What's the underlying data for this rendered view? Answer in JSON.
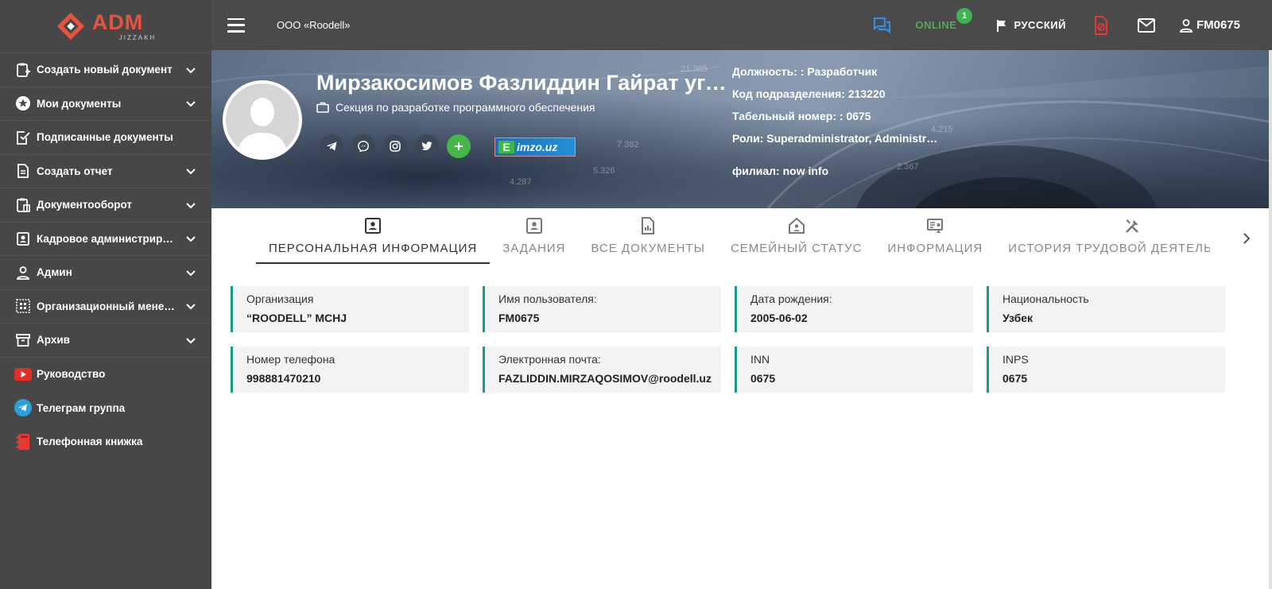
{
  "brand": {
    "title": "ADM",
    "subtitle": "JIZZAKH",
    "accent": "#e8533f"
  },
  "sidebar": {
    "items": [
      {
        "label": "Создать новый документ"
      },
      {
        "label": "Мои документы"
      },
      {
        "label": "Подписанные документы"
      },
      {
        "label": "Создать отчет"
      },
      {
        "label": "Документооборот"
      },
      {
        "label": "Кадровое администрирование"
      },
      {
        "label": "Админ"
      },
      {
        "label": "Организационный менеджмент"
      },
      {
        "label": "Архив"
      },
      {
        "label": "Руководство"
      },
      {
        "label": "Телеграм группа"
      },
      {
        "label": "Телефонная книжка"
      }
    ]
  },
  "topbar": {
    "organization": "ООО «Roodell»",
    "online_label": "ONLINE",
    "online_count": "1",
    "language": "РУССКИЙ",
    "username": "FM0675"
  },
  "profile": {
    "full_name": "Мирзакосимов Фазлиддин Гайрат угли",
    "department": "Секция по разработке программного обеспечения",
    "imzo_label": "imzo.uz",
    "imzo_letter": "E",
    "position": "Должность: : Разработчик",
    "division_code": "Код подразделения: 213220",
    "employee_number": "Табельный номер: : 0675",
    "roles": "Роли: Superadministrator, Administrator",
    "branch": "филиал: now info"
  },
  "tabs": [
    {
      "label": "ПЕРСОНАЛЬНАЯ ИНФОРМАЦИЯ",
      "active": true
    },
    {
      "label": "ЗАДАНИЯ"
    },
    {
      "label": "ВСЕ ДОКУМЕНТЫ"
    },
    {
      "label": "СЕМЕЙНЫЙ СТАТУС"
    },
    {
      "label": "ИНФОРМАЦИЯ"
    },
    {
      "label": "ИСТОРИЯ ТРУДОВОЙ ДЕЯТЕЛЬНОСТИ"
    }
  ],
  "fields": [
    {
      "label": "Организация",
      "value": "“ROODELL” MCHJ"
    },
    {
      "label": "Имя пользователя:",
      "value": "FM0675"
    },
    {
      "label": "Дата рождения:",
      "value": "2005-06-02"
    },
    {
      "label": "Национальность",
      "value": "Узбек"
    },
    {
      "label": "Номер телефона",
      "value": "998881470210"
    },
    {
      "label": "Электронная почта:",
      "value": "FAZLIDDIN.MIRZAQOSIMOV@roodell.uz"
    },
    {
      "label": "INN",
      "value": "0675"
    },
    {
      "label": "INPS",
      "value": "0675"
    }
  ],
  "colors": {
    "field_border": "#1a9a8a",
    "online": "#4caf50",
    "sidebar_bg": "#474747"
  }
}
